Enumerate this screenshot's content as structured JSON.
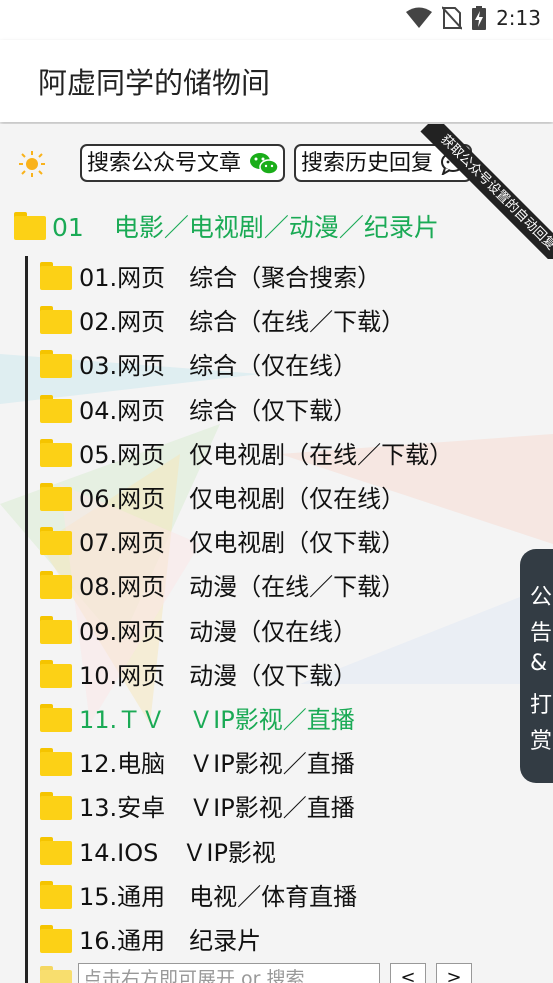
{
  "status": {
    "time": "2:13"
  },
  "app": {
    "title": "阿虚同学的储物间"
  },
  "toolbar": {
    "search_articles": "搜索公众号文章",
    "search_history": "搜索历史回复"
  },
  "ribbon": {
    "text": "获取公众号设置的自动回复"
  },
  "root": {
    "number": "01",
    "label": "电影／电视剧／动漫／纪录片"
  },
  "items": [
    {
      "label": "01.网页　综合（聚合搜索）"
    },
    {
      "label": "02.网页　综合（在线／下载）"
    },
    {
      "label": "03.网页　综合（仅在线）"
    },
    {
      "label": "04.网页　综合（仅下载）"
    },
    {
      "label": "05.网页　仅电视剧（在线／下载）"
    },
    {
      "label": "06.网页　仅电视剧（仅在线）"
    },
    {
      "label": "07.网页　仅电视剧（仅下载）"
    },
    {
      "label": "08.网页　动漫（在线／下载）"
    },
    {
      "label": "09.网页　动漫（仅在线）"
    },
    {
      "label": "10.网页　动漫（仅下载）"
    },
    {
      "label": "11.ＴＶ　ＶIP影视／直播"
    },
    {
      "label": "12.电脑　ＶIP影视／直播"
    },
    {
      "label": "13.安卓　ＶIP影视／直播"
    },
    {
      "label": "14.IOS　ＶIP影视"
    },
    {
      "label": "15.通用　电视／体育直播"
    },
    {
      "label": "16.通用　纪录片"
    }
  ],
  "side_tab": {
    "chars": [
      "公",
      "告",
      "&",
      "打",
      "赏"
    ]
  },
  "footer": {
    "placeholder": "点击右方即可展开 or 搜索",
    "prev": "<",
    "next": ">"
  },
  "colors": {
    "accent": "#1aaa55",
    "folder": "#fcd116",
    "side_tab": "#333c44"
  }
}
